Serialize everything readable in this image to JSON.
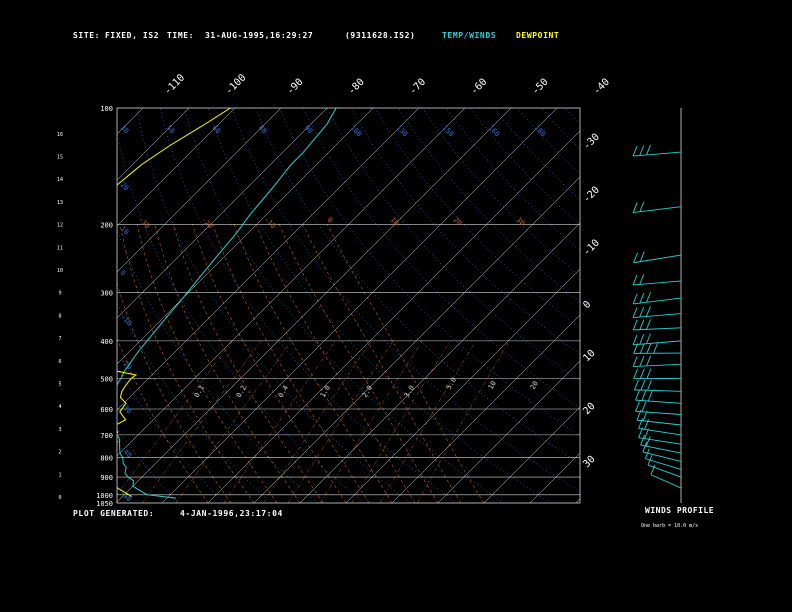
{
  "header": {
    "site_label": "SITE:",
    "site_value": "FIXED, IS2",
    "time_label": "TIME:",
    "time_value": "31-AUG-1995,16:29:27",
    "file_id": "(9311628.IS2)",
    "legend_temp": "TEMP/WINDS",
    "legend_dew": "DEWPOINT"
  },
  "footer": {
    "generated_label": "PLOT GENERATED:",
    "generated_value": "4-JAN-1996,23:17:04"
  },
  "winds_profile": {
    "title": "WINDS PROFILE",
    "note": "One barb = 10.0 m/s"
  },
  "colors": {
    "temp": "#2ad0d0",
    "dew": "#ffff00",
    "isotherm": "#d8d8d8",
    "grid": "#d8d8d8",
    "dry_adiabat": "#3a6fd0",
    "moist_adiabat": "#c06030",
    "mixing_ratio": "#c06030",
    "wind": "#2ad0d0"
  },
  "chart_data": {
    "type": "line",
    "title": "",
    "pressure_levels": [
      100,
      200,
      300,
      400,
      500,
      600,
      700,
      800,
      900,
      1000,
      1050
    ],
    "height_ticks_km": [
      0,
      1,
      2,
      3,
      4,
      5,
      6,
      7,
      8,
      9,
      10,
      11,
      12,
      13,
      14,
      15,
      16
    ],
    "top_temperature_labels": [
      "-110",
      "-100",
      "-90",
      "-80",
      "-70",
      "-60",
      "-50",
      "-40"
    ],
    "right_temperature_labels": [
      "-30",
      "-20",
      "-10",
      "0",
      "10",
      "20",
      "30"
    ],
    "dry_adiabat_labels_top": [
      "30",
      "50",
      "60",
      "80",
      "90",
      "100",
      "130",
      "150",
      "160",
      "180"
    ],
    "dry_adiabat_labels_left": [
      "20",
      "10",
      "0",
      "-10",
      "-20",
      "-30",
      "-40",
      "-50"
    ],
    "moist_adiabat_labels": [
      "-30",
      "-20",
      "-10",
      "0",
      "10",
      "20",
      "30"
    ],
    "mixing_ratio_labels": [
      "0.1",
      "0.2",
      "0.4",
      "1.0",
      "2.0",
      "3.0",
      "5.0",
      "10",
      "20"
    ],
    "series": [
      {
        "name": "TEMP/WINDS",
        "points": [
          [
            -28.0,
            1020
          ],
          [
            -35.0,
            1000
          ],
          [
            -37.0,
            980
          ],
          [
            -40.0,
            950
          ],
          [
            -41.0,
            920
          ],
          [
            -43.0,
            900
          ],
          [
            -44.5,
            880
          ],
          [
            -45.5,
            850
          ],
          [
            -47.0,
            830
          ],
          [
            -48.5,
            800
          ],
          [
            -50.0,
            780
          ],
          [
            -51.5,
            750
          ],
          [
            -53.0,
            720
          ],
          [
            -54.5,
            700
          ],
          [
            -56.0,
            680
          ],
          [
            -58.0,
            650
          ],
          [
            -60.0,
            630
          ],
          [
            -61.5,
            600
          ],
          [
            -63.0,
            580
          ],
          [
            -64.0,
            560
          ],
          [
            -64.8,
            540
          ],
          [
            -65.4,
            520
          ],
          [
            -65.8,
            510
          ],
          [
            -66.0,
            500
          ],
          [
            -66.8,
            480
          ],
          [
            -67.5,
            450
          ],
          [
            -68.0,
            430
          ],
          [
            -68.5,
            400
          ],
          [
            -69.0,
            370
          ],
          [
            -69.5,
            340
          ],
          [
            -70.0,
            310
          ],
          [
            -70.5,
            290
          ],
          [
            -71.0,
            270
          ],
          [
            -71.5,
            250
          ],
          [
            -72.0,
            230
          ],
          [
            -72.5,
            210
          ],
          [
            -73.0,
            200
          ],
          [
            -73.5,
            190
          ],
          [
            -74.0,
            175
          ],
          [
            -74.5,
            160
          ],
          [
            -75.0,
            150
          ],
          [
            -75.5,
            140
          ],
          [
            -75.5,
            130
          ],
          [
            -76.0,
            120
          ],
          [
            -76.5,
            110
          ],
          [
            -78.0,
            100
          ]
        ]
      },
      {
        "name": "DEWPOINT",
        "points": [
          [
            -38.0,
            1010
          ],
          [
            -40.0,
            990
          ],
          [
            -43.0,
            960
          ],
          [
            -45.0,
            930
          ],
          [
            -46.0,
            910
          ],
          [
            -49.0,
            880
          ],
          [
            -52.0,
            860
          ],
          [
            -55.0,
            830
          ],
          [
            -57.0,
            800
          ],
          [
            -52.0,
            790
          ],
          [
            -55.0,
            760
          ],
          [
            -53.0,
            730
          ],
          [
            -57.0,
            710
          ],
          [
            -55.0,
            690
          ],
          [
            -57.0,
            660
          ],
          [
            -56.0,
            640
          ],
          [
            -59.0,
            610
          ],
          [
            -59.5,
            580
          ],
          [
            -62.0,
            560
          ],
          [
            -63.0,
            540
          ],
          [
            -63.5,
            520
          ],
          [
            -63.8,
            500
          ],
          [
            -63.5,
            490
          ],
          [
            -68.0,
            480
          ],
          [
            -72.0,
            470
          ],
          [
            -78.0,
            455
          ],
          [
            -73.0,
            445
          ],
          [
            -80.0,
            430
          ],
          [
            -85.0,
            410
          ],
          [
            -89.0,
            395
          ],
          [
            -87.5,
            385
          ],
          [
            -91.0,
            375
          ],
          [
            -88.5,
            365
          ],
          [
            -92.0,
            350
          ],
          [
            -91.0,
            340
          ],
          [
            -94.0,
            325
          ],
          [
            -88.0,
            310
          ],
          [
            -90.0,
            300
          ],
          [
            -95.0,
            290
          ],
          [
            -93.0,
            280
          ],
          [
            -97.0,
            270
          ],
          [
            -100.0,
            260
          ],
          [
            -99.0,
            250
          ],
          [
            -104.0,
            240
          ],
          [
            -101.5,
            230
          ],
          [
            -105.0,
            220
          ],
          [
            -106.0,
            210
          ],
          [
            -105.5,
            200
          ],
          [
            -106.0,
            190
          ],
          [
            -108.0,
            175
          ],
          [
            -109.0,
            160
          ],
          [
            -108.0,
            140
          ],
          [
            -106.0,
            125
          ],
          [
            -103.0,
            110
          ],
          [
            -101.0,
            100
          ]
        ]
      }
    ],
    "wind_barbs": [
      {
        "pressure": 130,
        "speed_ms": 25,
        "dir_deg": 270
      },
      {
        "pressure": 180,
        "speed_ms": 20,
        "dir_deg": 275
      },
      {
        "pressure": 240,
        "speed_ms": 15,
        "dir_deg": 280
      },
      {
        "pressure": 280,
        "speed_ms": 20,
        "dir_deg": 270
      },
      {
        "pressure": 310,
        "speed_ms": 25,
        "dir_deg": 275
      },
      {
        "pressure": 340,
        "speed_ms": 25,
        "dir_deg": 270
      },
      {
        "pressure": 370,
        "speed_ms": 30,
        "dir_deg": 265
      },
      {
        "pressure": 400,
        "speed_ms": 30,
        "dir_deg": 270
      },
      {
        "pressure": 430,
        "speed_ms": 35,
        "dir_deg": 260
      },
      {
        "pressure": 460,
        "speed_ms": 30,
        "dir_deg": 265
      },
      {
        "pressure": 500,
        "speed_ms": 30,
        "dir_deg": 260
      },
      {
        "pressure": 540,
        "speed_ms": 25,
        "dir_deg": 255
      },
      {
        "pressure": 580,
        "speed_ms": 25,
        "dir_deg": 250
      },
      {
        "pressure": 620,
        "speed_ms": 20,
        "dir_deg": 250
      },
      {
        "pressure": 660,
        "speed_ms": 20,
        "dir_deg": 245
      },
      {
        "pressure": 700,
        "speed_ms": 20,
        "dir_deg": 240
      },
      {
        "pressure": 740,
        "speed_ms": 15,
        "dir_deg": 240
      },
      {
        "pressure": 780,
        "speed_ms": 15,
        "dir_deg": 235
      },
      {
        "pressure": 820,
        "speed_ms": 10,
        "dir_deg": 230
      },
      {
        "pressure": 860,
        "speed_ms": 10,
        "dir_deg": 225
      },
      {
        "pressure": 900,
        "speed_ms": 10,
        "dir_deg": 220
      },
      {
        "pressure": 960,
        "speed_ms": 5,
        "dir_deg": 215
      }
    ],
    "grid": true
  }
}
